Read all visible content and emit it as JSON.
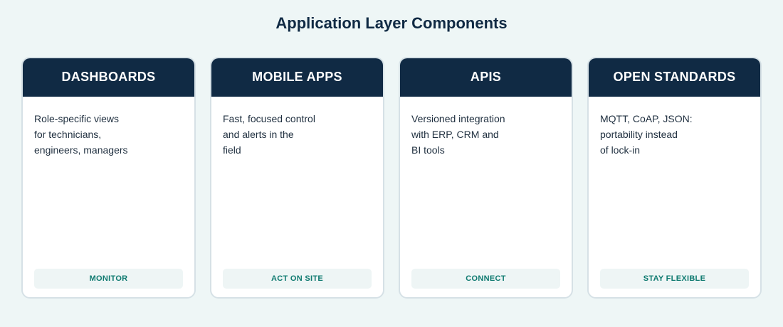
{
  "title": "Application Layer Components",
  "cards": [
    {
      "heading": "DASHBOARDS",
      "description": "Role-specific views\nfor technicians,\nengineers, managers",
      "tag": "MONITOR"
    },
    {
      "heading": "MOBILE APPS",
      "description": "Fast, focused control\nand alerts in the\nfield",
      "tag": "ACT ON SITE"
    },
    {
      "heading": "APIS",
      "description": "Versioned integration\nwith ERP, CRM and\nBI tools",
      "tag": "CONNECT"
    },
    {
      "heading": "OPEN STANDARDS",
      "description": "MQTT, CoAP, JSON:\nportability instead\nof lock-in",
      "tag": "STAY FLEXIBLE"
    }
  ],
  "colors": {
    "background": "#eef6f6",
    "header": "#102a44",
    "tag_text": "#0f7a70",
    "tag_background": "#eef5f5"
  }
}
